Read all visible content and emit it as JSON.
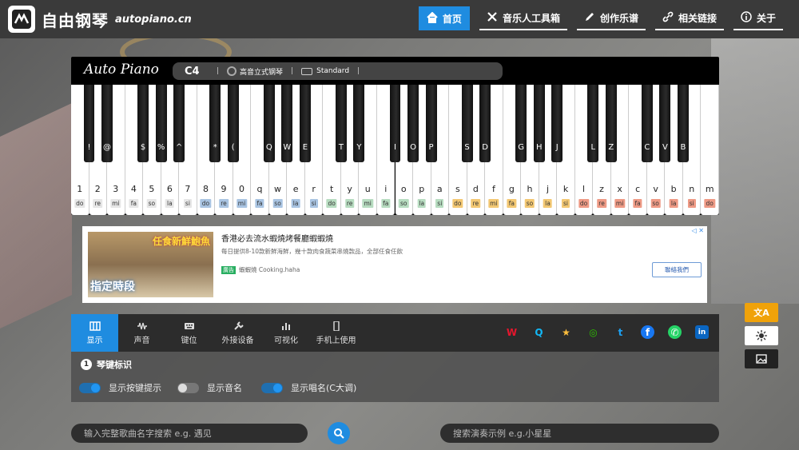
{
  "header": {
    "site_name": "自由钢琴",
    "domain": "autopiano.cn",
    "nav": [
      {
        "label": "首页",
        "icon": "home-icon",
        "active": true
      },
      {
        "label": "音乐人工具箱",
        "icon": "tools-icon",
        "active": false
      },
      {
        "label": "创作乐谱",
        "icon": "edit-icon",
        "active": false
      },
      {
        "label": "相关链接",
        "icon": "link-icon",
        "active": false
      },
      {
        "label": "关于",
        "icon": "info-icon",
        "active": false
      }
    ]
  },
  "piano": {
    "brand": "Auto Piano",
    "current_note": "C4",
    "instrument": "高音立式钢琴",
    "keyboard_mode": "Standard",
    "white_keys": [
      {
        "key": "1",
        "solfege": "do",
        "color": "#e6e6e6"
      },
      {
        "key": "2",
        "solfege": "re",
        "color": "#e6e6e6"
      },
      {
        "key": "3",
        "solfege": "mi",
        "color": "#e6e6e6"
      },
      {
        "key": "4",
        "solfege": "fa",
        "color": "#e6e6e6"
      },
      {
        "key": "5",
        "solfege": "so",
        "color": "#e6e6e6"
      },
      {
        "key": "6",
        "solfege": "la",
        "color": "#e6e6e6"
      },
      {
        "key": "7",
        "solfege": "si",
        "color": "#e6e6e6"
      },
      {
        "key": "8",
        "solfege": "do",
        "color": "#a9c4e2"
      },
      {
        "key": "9",
        "solfege": "re",
        "color": "#a9c4e2"
      },
      {
        "key": "0",
        "solfege": "mi",
        "color": "#a9c4e2"
      },
      {
        "key": "q",
        "solfege": "fa",
        "color": "#a9c4e2"
      },
      {
        "key": "w",
        "solfege": "so",
        "color": "#a9c4e2"
      },
      {
        "key": "e",
        "solfege": "la",
        "color": "#a9c4e2"
      },
      {
        "key": "r",
        "solfege": "si",
        "color": "#a9c4e2"
      },
      {
        "key": "t",
        "solfege": "do",
        "color": "#b7dcc0"
      },
      {
        "key": "y",
        "solfege": "re",
        "color": "#b7dcc0"
      },
      {
        "key": "u",
        "solfege": "mi",
        "color": "#b7dcc0"
      },
      {
        "key": "i",
        "solfege": "fa",
        "color": "#b7dcc0"
      },
      {
        "key": "o",
        "solfege": "so",
        "color": "#b7dcc0"
      },
      {
        "key": "p",
        "solfege": "la",
        "color": "#b7dcc0"
      },
      {
        "key": "a",
        "solfege": "si",
        "color": "#b7dcc0"
      },
      {
        "key": "s",
        "solfege": "do",
        "color": "#f3c873"
      },
      {
        "key": "d",
        "solfege": "re",
        "color": "#f3c873"
      },
      {
        "key": "f",
        "solfege": "mi",
        "color": "#f3c873"
      },
      {
        "key": "g",
        "solfege": "fa",
        "color": "#f3c873"
      },
      {
        "key": "h",
        "solfege": "so",
        "color": "#f3c873"
      },
      {
        "key": "j",
        "solfege": "la",
        "color": "#f3c873"
      },
      {
        "key": "k",
        "solfege": "si",
        "color": "#f3c873"
      },
      {
        "key": "l",
        "solfege": "do",
        "color": "#ee9a85"
      },
      {
        "key": "z",
        "solfege": "re",
        "color": "#ee9a85"
      },
      {
        "key": "x",
        "solfege": "mi",
        "color": "#ee9a85"
      },
      {
        "key": "c",
        "solfege": "fa",
        "color": "#ee9a85"
      },
      {
        "key": "v",
        "solfege": "so",
        "color": "#ee9a85"
      },
      {
        "key": "b",
        "solfege": "la",
        "color": "#ee9a85"
      },
      {
        "key": "n",
        "solfege": "si",
        "color": "#ee9a85"
      },
      {
        "key": "m",
        "solfege": "do",
        "color": "#ee9a85"
      }
    ],
    "black_keys": [
      "!",
      "@",
      "$",
      "%",
      "^",
      "*",
      "(",
      "Q",
      "W",
      "E",
      "T",
      "Y",
      "I",
      "O",
      "P",
      "S",
      "D",
      "G",
      "H",
      "J",
      "L",
      "Z",
      "C",
      "V",
      "B"
    ]
  },
  "ad": {
    "image_text_top": "任食新鮮鮑魚",
    "image_text_bottom": "指定時段",
    "title": "香港必去流水蝦燒烤餐廳蝦蝦燒",
    "description": "每日提供8-10款新鮮海鮮，幾十款肉食蔬菜串燒款品，全部任食任飲",
    "tag": "廣告",
    "advertiser": "蝦蝦燒 Cooking.haha",
    "button": "聯絡我們",
    "close": "◁ ✕"
  },
  "toolbar": {
    "tabs": [
      {
        "label": "显示",
        "icon": "piano-icon",
        "active": true
      },
      {
        "label": "声音",
        "icon": "waveform-icon",
        "active": false
      },
      {
        "label": "键位",
        "icon": "keyboard-icon",
        "active": false
      },
      {
        "label": "外接设备",
        "icon": "plug-icon",
        "active": false
      },
      {
        "label": "可视化",
        "icon": "bar-chart-icon",
        "active": false
      },
      {
        "label": "手机上使用",
        "icon": "mobile-icon",
        "active": false
      }
    ],
    "share": [
      {
        "name": "weibo-icon",
        "glyph": "W",
        "color": "#e6162d"
      },
      {
        "name": "qq-icon",
        "glyph": "Q",
        "color": "#12b7f5"
      },
      {
        "name": "qzone-icon",
        "glyph": "★",
        "color": "#fdbe3d"
      },
      {
        "name": "wechat-icon",
        "glyph": "◎",
        "color": "#2dc100"
      },
      {
        "name": "twitter-icon",
        "glyph": "t",
        "color": "#1da1f2"
      },
      {
        "name": "facebook-icon",
        "glyph": "f",
        "color": "#1877f2"
      },
      {
        "name": "whatsapp-icon",
        "glyph": "✆",
        "color": "#25d366"
      },
      {
        "name": "linkedin-icon",
        "glyph": "in",
        "color": "#0a66c2"
      }
    ]
  },
  "panel": {
    "step": "1",
    "title": "琴键标识",
    "toggles": [
      {
        "label": "显示按键提示",
        "on": true
      },
      {
        "label": "显示音名",
        "on": false
      },
      {
        "label": "显示唱名(C大调)",
        "on": true
      }
    ]
  },
  "search": {
    "song_placeholder": "输入完整歌曲名字搜索  e.g. 遇见",
    "demo_placeholder": "搜索演奏示例  e.g.小星星"
  },
  "side": {
    "translate": "文A"
  }
}
